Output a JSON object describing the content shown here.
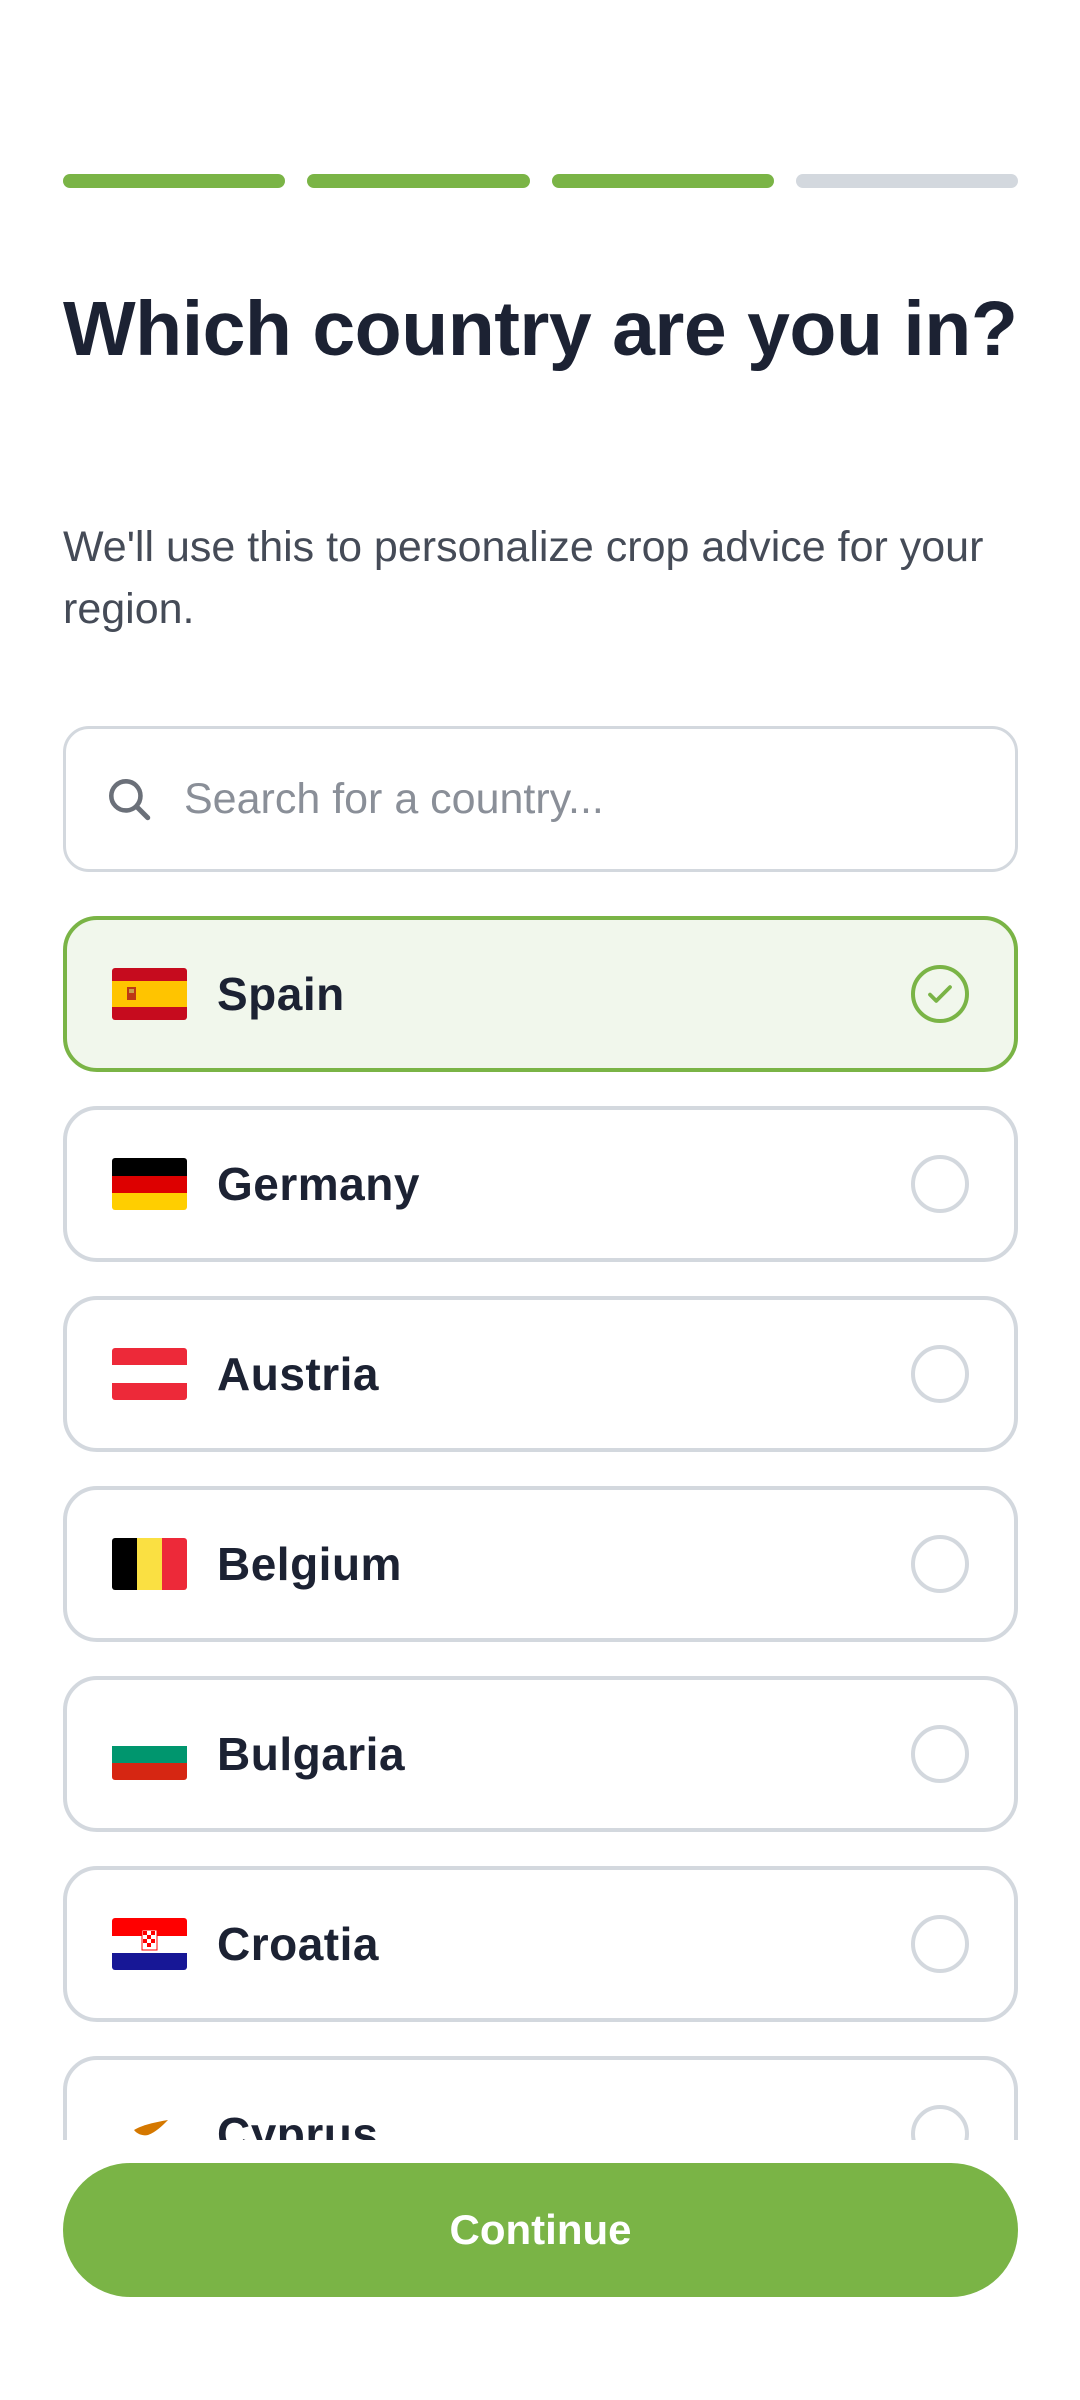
{
  "progress": {
    "total_steps": 4,
    "completed_steps": 3
  },
  "header": {
    "title": "Which country are you in?",
    "subtitle": "We'll use this to personalize crop advice for your region."
  },
  "search": {
    "placeholder": "Search for a country...",
    "value": "",
    "icon": "search-icon"
  },
  "countries": [
    {
      "name": "Spain",
      "selected": true,
      "icon": "flag-spain-icon"
    },
    {
      "name": "Germany",
      "selected": false,
      "icon": "flag-germany-icon"
    },
    {
      "name": "Austria",
      "selected": false,
      "icon": "flag-austria-icon"
    },
    {
      "name": "Belgium",
      "selected": false,
      "icon": "flag-belgium-icon"
    },
    {
      "name": "Bulgaria",
      "selected": false,
      "icon": "flag-bulgaria-icon"
    },
    {
      "name": "Croatia",
      "selected": false,
      "icon": "flag-croatia-icon"
    },
    {
      "name": "Cyprus",
      "selected": false,
      "icon": "flag-cyprus-icon"
    }
  ],
  "actions": {
    "continue_label": "Continue"
  },
  "colors": {
    "accent": "#7ab446",
    "selected_bg": "#f1f7ec",
    "border": "#d3d8de",
    "text": "#1c2233"
  }
}
